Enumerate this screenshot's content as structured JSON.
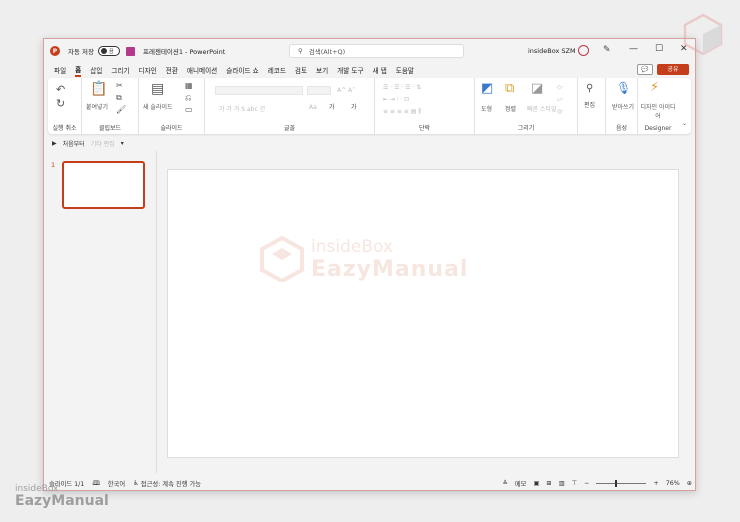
{
  "titlebar": {
    "autosave_label": "자동 저장",
    "autosave_state": "끔",
    "document_title": "프레젠테이션1 - PowerPoint",
    "search_placeholder": "검색(Alt+Q)",
    "user_name": "insideBox SZM",
    "minimize": "—",
    "maximize": "☐",
    "close": "✕"
  },
  "menu": {
    "items": [
      "파일",
      "홈",
      "삽입",
      "그리기",
      "디자인",
      "전환",
      "애니메이션",
      "슬라이드 쇼",
      "레코드",
      "검토",
      "보기",
      "개발 도구",
      "새 탭",
      "도움말"
    ],
    "active_index": 1,
    "comment_icon": "💬",
    "share_label": "공유"
  },
  "ribbon": {
    "groups": [
      "실행 취소",
      "클립보드",
      "슬라이드",
      "글꼴",
      "단락",
      "그리기",
      "음성",
      "Designer"
    ],
    "paste_label": "붙여넣기",
    "new_slide_label": "새 슬라이드",
    "shape_label": "도형",
    "arrange_label": "정렬",
    "quick_style_label": "빠른 스타일",
    "edit_label": "편집",
    "dictate_label": "받아쓰기",
    "designer_label": "디자인 아이디어",
    "font_color_label": "가",
    "highlight_label": "가"
  },
  "qat": {
    "start_label": "처음부터",
    "text_edit_label": "기타 편집",
    "more": "▾"
  },
  "slides": {
    "number": "1"
  },
  "canvas_watermark": {
    "top": "insideBox",
    "bottom": "EazyManual"
  },
  "status": {
    "slide_count": "슬라이드 1/1",
    "language": "한국어",
    "accessibility": "접근성: 계속 진행 가능",
    "notes": "메모",
    "zoom": "76%"
  },
  "external_watermark": {
    "top": "insideBox",
    "bottom": "EazyManual"
  },
  "colors": {
    "accent": "#c43e1c",
    "ribbon_bg": "#ffffff",
    "window_bg": "#f3f3f3"
  }
}
